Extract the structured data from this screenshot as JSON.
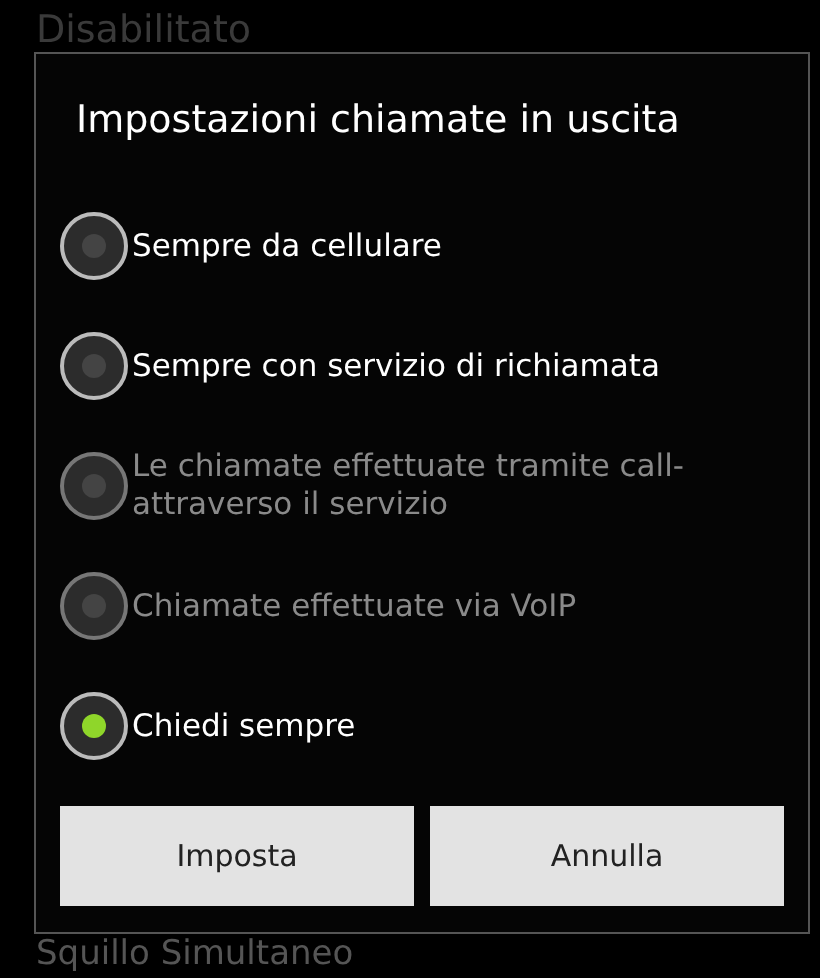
{
  "background": {
    "top_text": "Disabilitato",
    "bottom_text": "Squillo Simultaneo"
  },
  "dialog": {
    "title": "Impostazioni chiamate in uscita",
    "options": [
      {
        "label": "Sempre da cellulare",
        "selected": false,
        "disabled": false
      },
      {
        "label": "Sempre con servizio di richiamata",
        "selected": false,
        "disabled": false
      },
      {
        "label": "Le chiamate effettuate tramite call-attraverso il servizio",
        "selected": false,
        "disabled": true
      },
      {
        "label": "Chiamate effettuate via VoIP",
        "selected": false,
        "disabled": true
      },
      {
        "label": "Chiedi sempre",
        "selected": true,
        "disabled": false
      }
    ],
    "buttons": [
      "Imposta",
      "Annulla"
    ]
  }
}
